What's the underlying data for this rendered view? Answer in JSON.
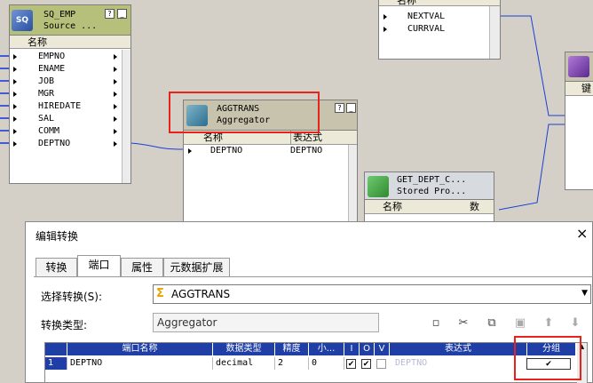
{
  "canvas": {
    "sq_emp": {
      "title": "SQ_EMP",
      "subtitle": "Source ...",
      "col_header": "名称",
      "icon": "source-qualifier-icon",
      "ports": [
        "EMPNO",
        "ENAME",
        "JOB",
        "MGR",
        "HIREDATE",
        "SAL",
        "COMM",
        "DEPTNO"
      ]
    },
    "seq_node": {
      "col_header": "名称",
      "ports": [
        "NEXTVAL",
        "CURRVAL"
      ]
    },
    "aggtrans": {
      "title": "AGGTRANS",
      "subtitle": "Aggregator",
      "col_name": "名称",
      "col_expr": "表达式",
      "icon": "aggregator-icon",
      "rows": [
        {
          "name": "DEPTNO",
          "expr": "DEPTNO"
        }
      ]
    },
    "get_dept": {
      "title": "GET_DEPT_C...",
      "subtitle": "Stored Pro...",
      "col_name": "名称",
      "col_num": "数",
      "icon": "stored-procedure-icon"
    },
    "target_node": {
      "label": "键",
      "icon": "target-icon"
    },
    "window_buttons": {
      "help": "?",
      "minimize": "_"
    }
  },
  "dialog": {
    "title": "编辑转换",
    "close": "×",
    "tabs": [
      "转换",
      "端口",
      "属性",
      "元数据扩展"
    ],
    "active_tab": 1,
    "select_label": "选择转换(S):",
    "select_value": "AGGTRANS",
    "type_label": "转换类型:",
    "type_value": "Aggregator",
    "toolbar_icons": [
      "new-port-icon",
      "cut-icon",
      "copy-icon",
      "paste-icon",
      "move-up-icon",
      "move-down-icon"
    ],
    "grid": {
      "headers": [
        "端口名称",
        "数据类型",
        "精度",
        "小...",
        "I",
        "O",
        "V",
        "表达式",
        "分组"
      ],
      "rows": [
        {
          "num": "1",
          "name": "DEPTNO",
          "type": "decimal",
          "precision": "2",
          "scale": "0",
          "i": true,
          "o": true,
          "v": false,
          "expr": "DEPTNO",
          "group": true
        }
      ]
    }
  },
  "colors": {
    "canvas": "#d4d0c8",
    "node_header": "#c7c3ac",
    "grid_header": "#1f3fa6",
    "highlight": "#e8231c",
    "link": "#1a3fd6"
  }
}
